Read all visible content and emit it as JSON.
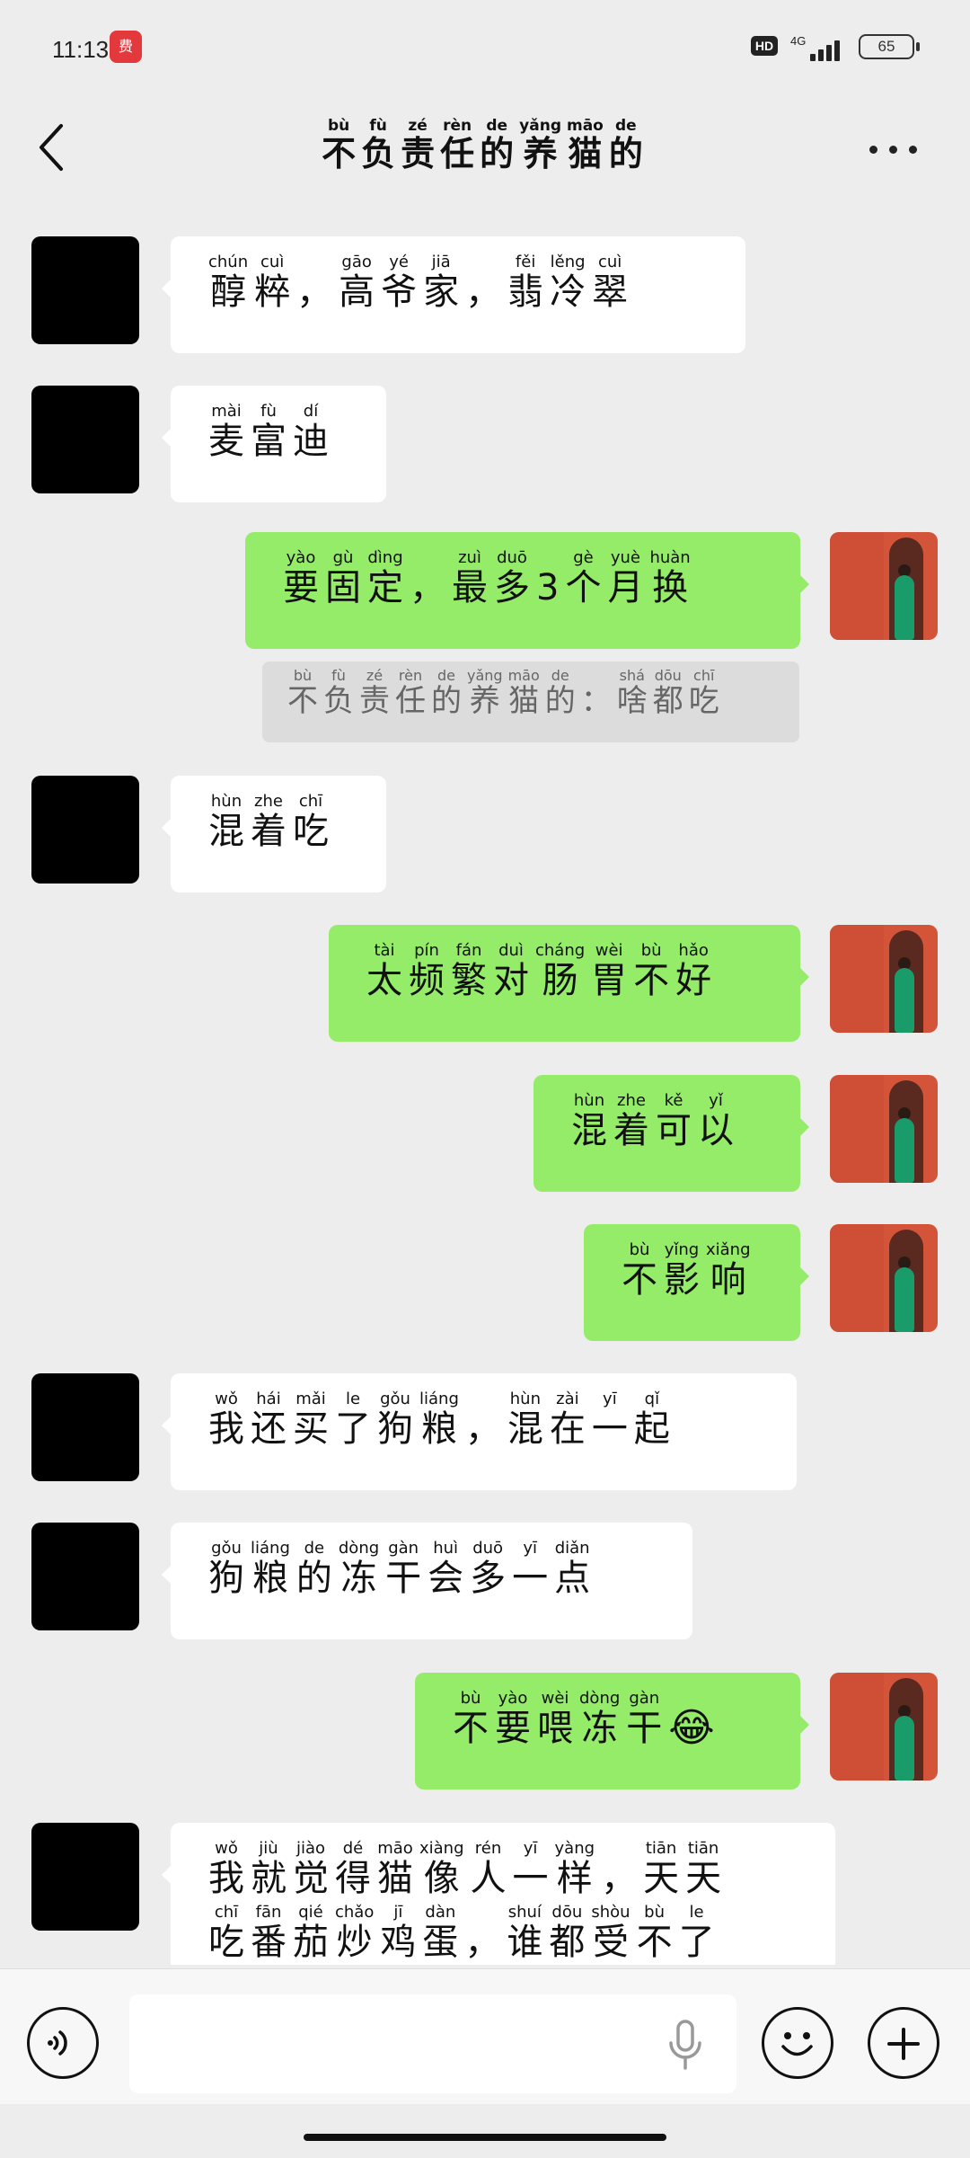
{
  "status_bar": {
    "time": "11:13",
    "app_badge": "费",
    "hd_label": "HD",
    "network_label": "4G",
    "battery_level": "65"
  },
  "header": {
    "title": [
      {
        "c": "不",
        "p": "bù"
      },
      {
        "c": "负",
        "p": "fù"
      },
      {
        "c": "责",
        "p": "zé"
      },
      {
        "c": "任",
        "p": "rèn"
      },
      {
        "c": "的",
        "p": "de"
      },
      {
        "c": "养",
        "p": "yǎng"
      },
      {
        "c": "猫",
        "p": "māo"
      },
      {
        "c": "的",
        "p": "de"
      }
    ]
  },
  "messages": [
    {
      "side": "in",
      "lines": [
        [
          {
            "c": "醇",
            "p": "chún"
          },
          {
            "c": "粹",
            "p": "cuì"
          },
          {
            "c": "，",
            "p": ""
          },
          {
            "c": "高",
            "p": "gāo"
          },
          {
            "c": "爷",
            "p": "yé"
          },
          {
            "c": "家",
            "p": "jiā"
          },
          {
            "c": "，",
            "p": ""
          },
          {
            "c": "翡",
            "p": "fěi"
          },
          {
            "c": "冷",
            "p": "lěng"
          },
          {
            "c": "翠",
            "p": "cuì"
          }
        ]
      ]
    },
    {
      "side": "in",
      "lines": [
        [
          {
            "c": "麦",
            "p": "mài"
          },
          {
            "c": "富",
            "p": "fù"
          },
          {
            "c": "迪",
            "p": "dí"
          }
        ]
      ]
    },
    {
      "side": "out",
      "lines": [
        [
          {
            "c": "要",
            "p": "yào"
          },
          {
            "c": "固",
            "p": "gù"
          },
          {
            "c": "定",
            "p": "dìng"
          },
          {
            "c": "，",
            "p": ""
          },
          {
            "c": "最",
            "p": "zuì"
          },
          {
            "c": "多",
            "p": "duō"
          },
          {
            "c": "3",
            "p": ""
          },
          {
            "c": "个",
            "p": "gè"
          },
          {
            "c": "月",
            "p": "yuè"
          },
          {
            "c": "换",
            "p": "huàn"
          }
        ]
      ]
    },
    {
      "side": "system",
      "lines": [
        [
          {
            "c": "不",
            "p": "bù"
          },
          {
            "c": "负",
            "p": "fù"
          },
          {
            "c": "责",
            "p": "zé"
          },
          {
            "c": "任",
            "p": "rèn"
          },
          {
            "c": "的",
            "p": "de"
          },
          {
            "c": "养",
            "p": "yǎng"
          },
          {
            "c": "猫",
            "p": "māo"
          },
          {
            "c": "的",
            "p": "de"
          },
          {
            "c": "：",
            "p": ""
          },
          {
            "c": "啥",
            "p": "shá"
          },
          {
            "c": "都",
            "p": "dōu"
          },
          {
            "c": "吃",
            "p": "chī"
          }
        ]
      ]
    },
    {
      "side": "in",
      "lines": [
        [
          {
            "c": "混",
            "p": "hùn"
          },
          {
            "c": "着",
            "p": "zhe"
          },
          {
            "c": "吃",
            "p": "chī"
          }
        ]
      ]
    },
    {
      "side": "out",
      "lines": [
        [
          {
            "c": "太",
            "p": "tài"
          },
          {
            "c": "频",
            "p": "pín"
          },
          {
            "c": "繁",
            "p": "fán"
          },
          {
            "c": "对",
            "p": "duì"
          },
          {
            "c": "肠",
            "p": "cháng"
          },
          {
            "c": "胃",
            "p": "wèi"
          },
          {
            "c": "不",
            "p": "bù"
          },
          {
            "c": "好",
            "p": "hǎo"
          }
        ]
      ]
    },
    {
      "side": "out",
      "lines": [
        [
          {
            "c": "混",
            "p": "hùn"
          },
          {
            "c": "着",
            "p": "zhe"
          },
          {
            "c": "可",
            "p": "kě"
          },
          {
            "c": "以",
            "p": "yǐ"
          }
        ]
      ]
    },
    {
      "side": "out",
      "lines": [
        [
          {
            "c": "不",
            "p": "bù"
          },
          {
            "c": "影",
            "p": "yǐng"
          },
          {
            "c": "响",
            "p": "xiǎng"
          }
        ]
      ]
    },
    {
      "side": "in",
      "lines": [
        [
          {
            "c": "我",
            "p": "wǒ"
          },
          {
            "c": "还",
            "p": "hái"
          },
          {
            "c": "买",
            "p": "mǎi"
          },
          {
            "c": "了",
            "p": "le"
          },
          {
            "c": "狗",
            "p": "gǒu"
          },
          {
            "c": "粮",
            "p": "liáng"
          },
          {
            "c": "，",
            "p": ""
          },
          {
            "c": "混",
            "p": "hùn"
          },
          {
            "c": "在",
            "p": "zài"
          },
          {
            "c": "一",
            "p": "yī"
          },
          {
            "c": "起",
            "p": "qǐ"
          }
        ]
      ]
    },
    {
      "side": "in",
      "lines": [
        [
          {
            "c": "狗",
            "p": "gǒu"
          },
          {
            "c": "粮",
            "p": "liáng"
          },
          {
            "c": "的",
            "p": "de"
          },
          {
            "c": "冻",
            "p": "dòng"
          },
          {
            "c": "干",
            "p": "gàn"
          },
          {
            "c": "会",
            "p": "huì"
          },
          {
            "c": "多",
            "p": "duō"
          },
          {
            "c": "一",
            "p": "yī"
          },
          {
            "c": "点",
            "p": "diǎn"
          }
        ]
      ]
    },
    {
      "side": "out",
      "emoji": "😂",
      "lines": [
        [
          {
            "c": "不",
            "p": "bù"
          },
          {
            "c": "要",
            "p": "yào"
          },
          {
            "c": "喂",
            "p": "wèi"
          },
          {
            "c": "冻",
            "p": "dòng"
          },
          {
            "c": "干",
            "p": "gàn"
          }
        ]
      ]
    },
    {
      "side": "in",
      "lines": [
        [
          {
            "c": "我",
            "p": "wǒ"
          },
          {
            "c": "就",
            "p": "jiù"
          },
          {
            "c": "觉",
            "p": "jiào"
          },
          {
            "c": "得",
            "p": "dé"
          },
          {
            "c": "猫",
            "p": "māo"
          },
          {
            "c": "像",
            "p": "xiàng"
          },
          {
            "c": "人",
            "p": "rén"
          },
          {
            "c": "一",
            "p": "yī"
          },
          {
            "c": "样",
            "p": "yàng"
          },
          {
            "c": "，",
            "p": ""
          },
          {
            "c": "天",
            "p": "tiān"
          },
          {
            "c": "天",
            "p": "tiān"
          }
        ],
        [
          {
            "c": "吃",
            "p": "chī"
          },
          {
            "c": "番",
            "p": "fān"
          },
          {
            "c": "茄",
            "p": "qié"
          },
          {
            "c": "炒",
            "p": "chǎo"
          },
          {
            "c": "鸡",
            "p": "jī"
          },
          {
            "c": "蛋",
            "p": "dàn"
          },
          {
            "c": "，",
            "p": ""
          },
          {
            "c": "谁",
            "p": "shuí"
          },
          {
            "c": "都",
            "p": "dōu"
          },
          {
            "c": "受",
            "p": "shòu"
          },
          {
            "c": "不",
            "p": "bù"
          },
          {
            "c": "了",
            "p": "le"
          }
        ]
      ]
    }
  ],
  "input": {
    "placeholder": ""
  },
  "icons": {
    "back": "chevron-left-icon",
    "more": "more-dots-icon",
    "voice": "voice-icon",
    "mic": "microphone-icon",
    "emoji": "smiley-icon",
    "plus": "plus-icon"
  }
}
